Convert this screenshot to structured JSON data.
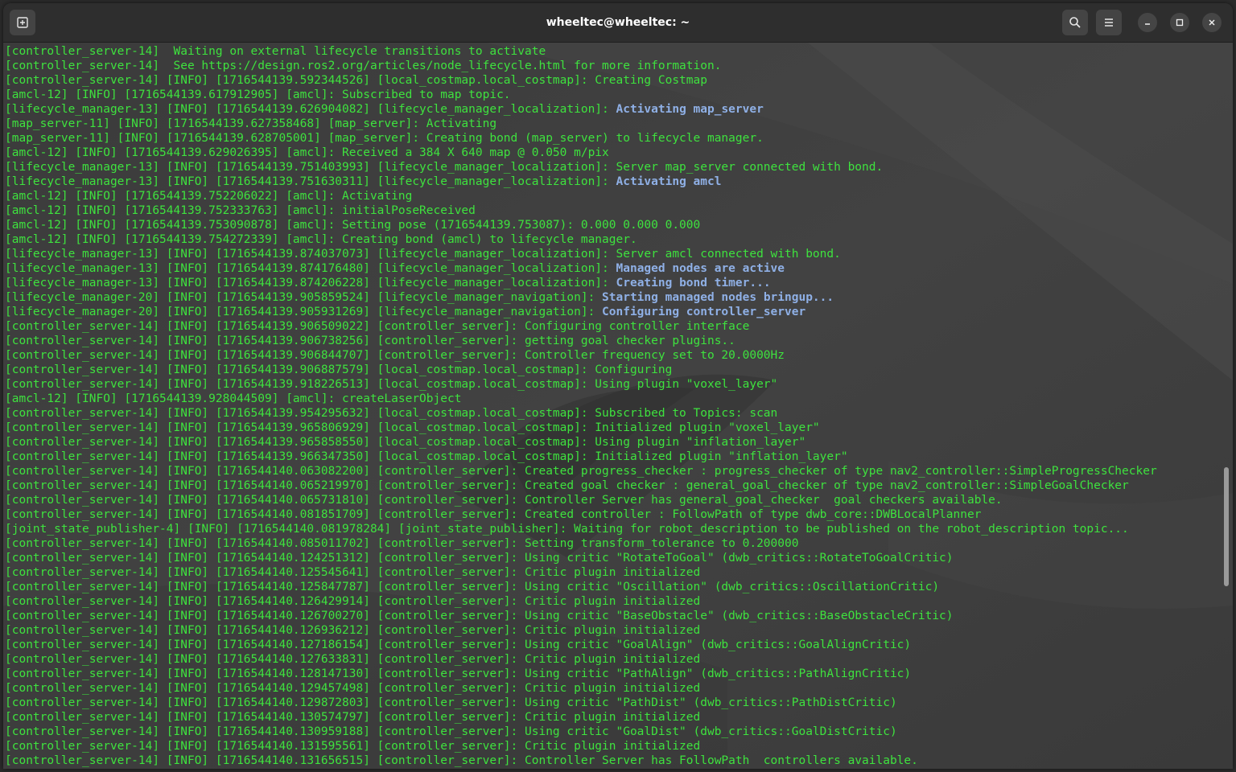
{
  "window": {
    "title": "wheeltec@wheeltec: ~"
  },
  "icons": {
    "new_tab": "new-tab-icon",
    "search": "search-icon",
    "menu": "hamburger-menu-icon",
    "minimize": "minimize-icon",
    "maximize": "maximize-icon",
    "close": "close-icon"
  },
  "colors": {
    "log_text": "#3ee23e",
    "highlight_text": "#8fb0e6",
    "titlebar": "#2e2e2e",
    "terminal_bg": "#3d3d3d"
  },
  "terminal": {
    "lines": [
      {
        "text": "[controller_server-14]  Waiting on external lifecycle transitions to activate"
      },
      {
        "text": "[controller_server-14]  See https://design.ros2.org/articles/node_lifecycle.html for more information."
      },
      {
        "text": "[controller_server-14] [INFO] [1716544139.592344526] [local_costmap.local_costmap]: Creating Costmap"
      },
      {
        "text": "[amcl-12] [INFO] [1716544139.617912905] [amcl]: Subscribed to map topic."
      },
      {
        "text": "[lifecycle_manager-13] [INFO] [1716544139.626904082] [lifecycle_manager_localization]: ",
        "highlight": "Activating map_server"
      },
      {
        "text": "[map_server-11] [INFO] [1716544139.627358468] [map_server]: Activating"
      },
      {
        "text": "[map_server-11] [INFO] [1716544139.628705001] [map_server]: Creating bond (map_server) to lifecycle manager."
      },
      {
        "text": "[amcl-12] [INFO] [1716544139.629026395] [amcl]: Received a 384 X 640 map @ 0.050 m/pix"
      },
      {
        "text": "[lifecycle_manager-13] [INFO] [1716544139.751403993] [lifecycle_manager_localization]: Server map_server connected with bond."
      },
      {
        "text": "[lifecycle_manager-13] [INFO] [1716544139.751630311] [lifecycle_manager_localization]: ",
        "highlight": "Activating amcl"
      },
      {
        "text": "[amcl-12] [INFO] [1716544139.752206022] [amcl]: Activating"
      },
      {
        "text": "[amcl-12] [INFO] [1716544139.752333763] [amcl]: initialPoseReceived"
      },
      {
        "text": "[amcl-12] [INFO] [1716544139.753090878] [amcl]: Setting pose (1716544139.753087): 0.000 0.000 0.000"
      },
      {
        "text": "[amcl-12] [INFO] [1716544139.754272339] [amcl]: Creating bond (amcl) to lifecycle manager."
      },
      {
        "text": "[lifecycle_manager-13] [INFO] [1716544139.874037073] [lifecycle_manager_localization]: Server amcl connected with bond."
      },
      {
        "text": "[lifecycle_manager-13] [INFO] [1716544139.874176480] [lifecycle_manager_localization]: ",
        "highlight": "Managed nodes are active"
      },
      {
        "text": "[lifecycle_manager-13] [INFO] [1716544139.874206228] [lifecycle_manager_localization]: ",
        "highlight": "Creating bond timer..."
      },
      {
        "text": "[lifecycle_manager-20] [INFO] [1716544139.905859524] [lifecycle_manager_navigation]: ",
        "highlight": "Starting managed nodes bringup..."
      },
      {
        "text": "[lifecycle_manager-20] [INFO] [1716544139.905931269] [lifecycle_manager_navigation]: ",
        "highlight": "Configuring controller_server"
      },
      {
        "text": "[controller_server-14] [INFO] [1716544139.906509022] [controller_server]: Configuring controller interface"
      },
      {
        "text": "[controller_server-14] [INFO] [1716544139.906738256] [controller_server]: getting goal checker plugins.."
      },
      {
        "text": "[controller_server-14] [INFO] [1716544139.906844707] [controller_server]: Controller frequency set to 20.0000Hz"
      },
      {
        "text": "[controller_server-14] [INFO] [1716544139.906887579] [local_costmap.local_costmap]: Configuring"
      },
      {
        "text": "[controller_server-14] [INFO] [1716544139.918226513] [local_costmap.local_costmap]: Using plugin \"voxel_layer\""
      },
      {
        "text": "[amcl-12] [INFO] [1716544139.928044509] [amcl]: createLaserObject"
      },
      {
        "text": "[controller_server-14] [INFO] [1716544139.954295632] [local_costmap.local_costmap]: Subscribed to Topics: scan"
      },
      {
        "text": "[controller_server-14] [INFO] [1716544139.965806929] [local_costmap.local_costmap]: Initialized plugin \"voxel_layer\""
      },
      {
        "text": "[controller_server-14] [INFO] [1716544139.965858550] [local_costmap.local_costmap]: Using plugin \"inflation_layer\""
      },
      {
        "text": "[controller_server-14] [INFO] [1716544139.966347350] [local_costmap.local_costmap]: Initialized plugin \"inflation_layer\""
      },
      {
        "text": "[controller_server-14] [INFO] [1716544140.063082200] [controller_server]: Created progress_checker : progress_checker of type nav2_controller::SimpleProgressChecker"
      },
      {
        "text": "[controller_server-14] [INFO] [1716544140.065219970] [controller_server]: Created goal checker : general_goal_checker of type nav2_controller::SimpleGoalChecker"
      },
      {
        "text": "[controller_server-14] [INFO] [1716544140.065731810] [controller_server]: Controller Server has general_goal_checker  goal checkers available."
      },
      {
        "text": "[controller_server-14] [INFO] [1716544140.081851709] [controller_server]: Created controller : FollowPath of type dwb_core::DWBLocalPlanner"
      },
      {
        "text": "[joint_state_publisher-4] [INFO] [1716544140.081978284] [joint_state_publisher]: Waiting for robot_description to be published on the robot_description topic..."
      },
      {
        "text": "[controller_server-14] [INFO] [1716544140.085011702] [controller_server]: Setting transform_tolerance to 0.200000"
      },
      {
        "text": "[controller_server-14] [INFO] [1716544140.124251312] [controller_server]: Using critic \"RotateToGoal\" (dwb_critics::RotateToGoalCritic)"
      },
      {
        "text": "[controller_server-14] [INFO] [1716544140.125545641] [controller_server]: Critic plugin initialized"
      },
      {
        "text": "[controller_server-14] [INFO] [1716544140.125847787] [controller_server]: Using critic \"Oscillation\" (dwb_critics::OscillationCritic)"
      },
      {
        "text": "[controller_server-14] [INFO] [1716544140.126429914] [controller_server]: Critic plugin initialized"
      },
      {
        "text": "[controller_server-14] [INFO] [1716544140.126700270] [controller_server]: Using critic \"BaseObstacle\" (dwb_critics::BaseObstacleCritic)"
      },
      {
        "text": "[controller_server-14] [INFO] [1716544140.126936212] [controller_server]: Critic plugin initialized"
      },
      {
        "text": "[controller_server-14] [INFO] [1716544140.127186154] [controller_server]: Using critic \"GoalAlign\" (dwb_critics::GoalAlignCritic)"
      },
      {
        "text": "[controller_server-14] [INFO] [1716544140.127633831] [controller_server]: Critic plugin initialized"
      },
      {
        "text": "[controller_server-14] [INFO] [1716544140.128147130] [controller_server]: Using critic \"PathAlign\" (dwb_critics::PathAlignCritic)"
      },
      {
        "text": "[controller_server-14] [INFO] [1716544140.129457498] [controller_server]: Critic plugin initialized"
      },
      {
        "text": "[controller_server-14] [INFO] [1716544140.129872803] [controller_server]: Using critic \"PathDist\" (dwb_critics::PathDistCritic)"
      },
      {
        "text": "[controller_server-14] [INFO] [1716544140.130574797] [controller_server]: Critic plugin initialized"
      },
      {
        "text": "[controller_server-14] [INFO] [1716544140.130959188] [controller_server]: Using critic \"GoalDist\" (dwb_critics::GoalDistCritic)"
      },
      {
        "text": "[controller_server-14] [INFO] [1716544140.131595561] [controller_server]: Critic plugin initialized"
      },
      {
        "text": "[controller_server-14] [INFO] [1716544140.131656515] [controller_server]: Controller Server has FollowPath  controllers available."
      }
    ]
  }
}
